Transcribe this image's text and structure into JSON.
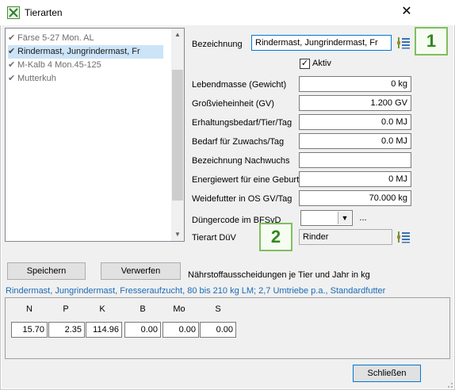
{
  "window": {
    "title": "Tierarten",
    "close_glyph": "✕"
  },
  "list": {
    "items": [
      {
        "label": "Färse 5-27 Mon. AL",
        "selected": false
      },
      {
        "label": "Rindermast, Jungrindermast, Fr",
        "selected": true
      },
      {
        "label": "M-Kalb 4 Mon.45-125",
        "selected": false
      },
      {
        "label": "Mutterkuh",
        "selected": false
      }
    ],
    "check_glyph": "✔"
  },
  "buttons": {
    "save": "Speichern",
    "discard": "Verwerfen",
    "close": "Schließen",
    "dots": "..."
  },
  "form": {
    "bezeichnung_label": "Bezeichnung",
    "bezeichnung_value": "Rindermast, Jungrindermast, Fr",
    "aktiv_label": "Aktiv",
    "aktiv_checked": true,
    "lebendmasse_label": "Lebendmasse (Gewicht)",
    "lebendmasse_value": "0 kg",
    "gv_label": "Großvieheinheit (GV)",
    "gv_value": "1.200 GV",
    "erhaltung_label": "Erhaltungsbedarf/Tier/Tag",
    "erhaltung_value": "0.0 MJ",
    "zuwachs_label": "Bedarf für Zuwachs/Tag",
    "zuwachs_value": "0.0 MJ",
    "nachwuchs_label": "Bezeichnung Nachwuchs",
    "nachwuchs_value": "",
    "energie_label": "Energiewert für eine Geburt",
    "energie_value": "0 MJ",
    "weidefutter_label": "Weidefutter in OS GV/Tag",
    "weidefutter_value": "70.000 kg",
    "duenger_label": "Düngercode im BFSvD",
    "duenger_value": "",
    "tierart_label": "Tierart DüV",
    "tierart_value": "Rinder"
  },
  "badges": {
    "one": "1",
    "two": "2"
  },
  "naehrstoff": {
    "heading": "Nährstoffausscheidungen je Tier und Jahr in kg",
    "description": "Rindermast, Jungrindermast, Fresseraufzucht, 80 bis 210 kg LM; 2,7 Umtriebe p.a., Standardfutter",
    "columns": [
      {
        "name": "N",
        "value": "15.70"
      },
      {
        "name": "P",
        "value": "2.35"
      },
      {
        "name": "K",
        "value": "114.96"
      },
      {
        "name": "B",
        "value": "0.00"
      },
      {
        "name": "Mo",
        "value": "0.00"
      },
      {
        "name": "S",
        "value": "0.00"
      }
    ]
  },
  "colors": {
    "selection": "#cce4f7",
    "link_text": "#1a6bb8",
    "badge_green": "#2f8a1e"
  }
}
